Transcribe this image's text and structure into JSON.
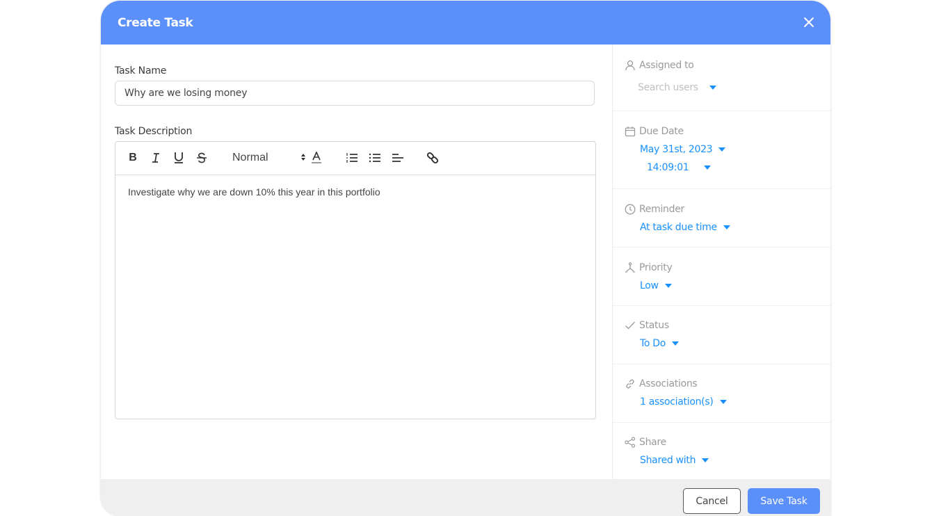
{
  "dialog": {
    "title": "Create Task",
    "close_icon": "close-icon"
  },
  "form": {
    "task_name_label": "Task Name",
    "task_name_value": "Why are we losing money",
    "task_description_label": "Task Description",
    "toolbar": {
      "bold": "B",
      "italic": "I",
      "underline": "U",
      "strike": "S",
      "format_value": "Normal",
      "icons": [
        "bold-icon",
        "italic-icon",
        "underline-icon",
        "strikethrough-icon",
        "format-select",
        "text-color-icon",
        "ordered-list-icon",
        "bullet-list-icon",
        "align-icon",
        "link-icon"
      ]
    },
    "description_value": "Investigate why we are down 10% this year in this portfolio"
  },
  "sidebar": {
    "assigned_to": {
      "label": "Assigned to",
      "placeholder": "Search users",
      "icon": "user-icon"
    },
    "due_date": {
      "label": "Due Date",
      "date": "May 31st, 2023",
      "time": "14:09:01",
      "icon": "calendar-icon"
    },
    "reminder": {
      "label": "Reminder",
      "value": "At task due time",
      "icon": "clock-icon"
    },
    "priority": {
      "label": "Priority",
      "value": "Low",
      "icon": "priority-icon"
    },
    "status": {
      "label": "Status",
      "value": "To Do",
      "icon": "check-icon"
    },
    "associations": {
      "label": "Associations",
      "value": "1 association(s)",
      "icon": "link-icon"
    },
    "share": {
      "label": "Share",
      "value": "Shared with",
      "icon": "share-icon"
    }
  },
  "footer": {
    "cancel_label": "Cancel",
    "save_label": "Save Task"
  },
  "colors": {
    "header": "#5b8ff9",
    "accent": "#1890ff",
    "footer_bg": "#efefef"
  }
}
